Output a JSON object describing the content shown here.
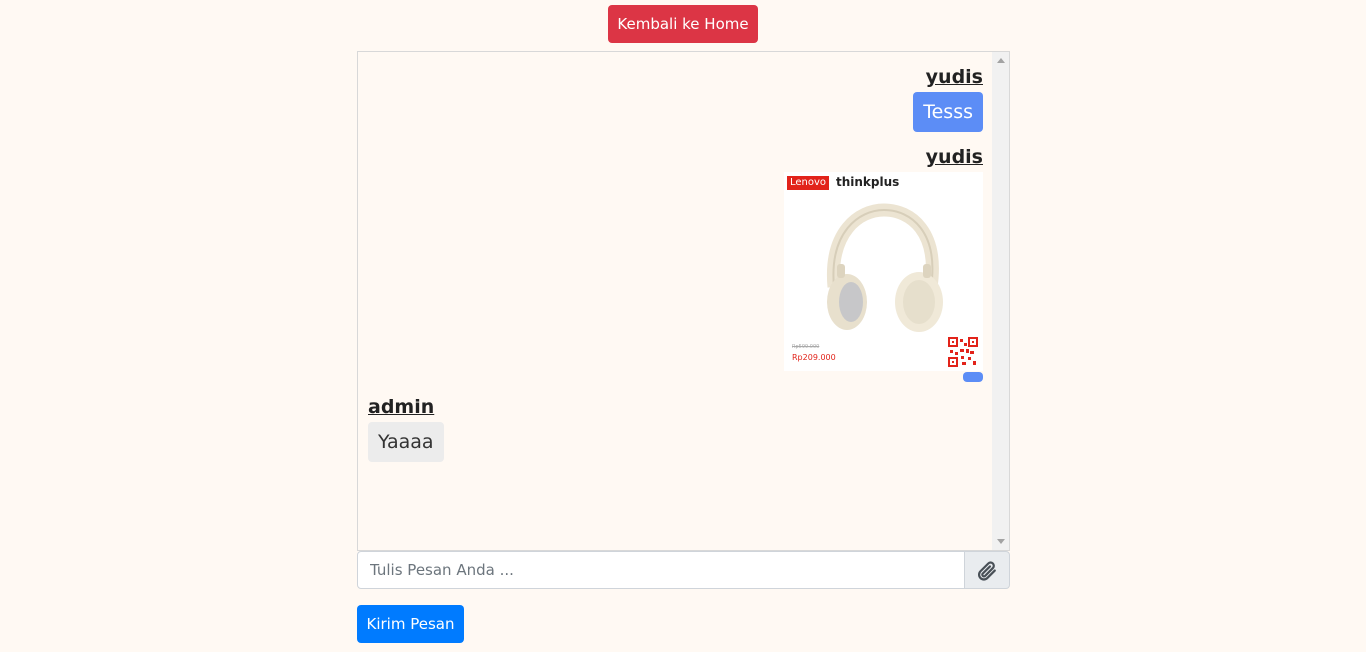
{
  "header": {
    "home_button_label": "Kembali ke Home"
  },
  "chat": {
    "messages": [
      {
        "sender": "yudis",
        "text": "Tesss",
        "side": "right",
        "type": "text"
      },
      {
        "sender": "yudis",
        "side": "right",
        "type": "image",
        "image": {
          "brand": "Lenovo",
          "sub_brand": "thinkplus",
          "old_price": "Rp599.000",
          "price": "Rp209.000"
        }
      },
      {
        "sender": "admin",
        "text": "Yaaaa",
        "side": "left",
        "type": "text"
      }
    ]
  },
  "composer": {
    "placeholder": "Tulis Pesan Anda ...",
    "value": "",
    "attach_icon": "paperclip-icon",
    "send_label": "Kirim Pesan"
  },
  "colors": {
    "page_bg": "#fff9f3",
    "danger": "#dc3545",
    "primary": "#007bff",
    "user_bubble": "#5c8df6",
    "admin_bubble": "#ececec"
  }
}
